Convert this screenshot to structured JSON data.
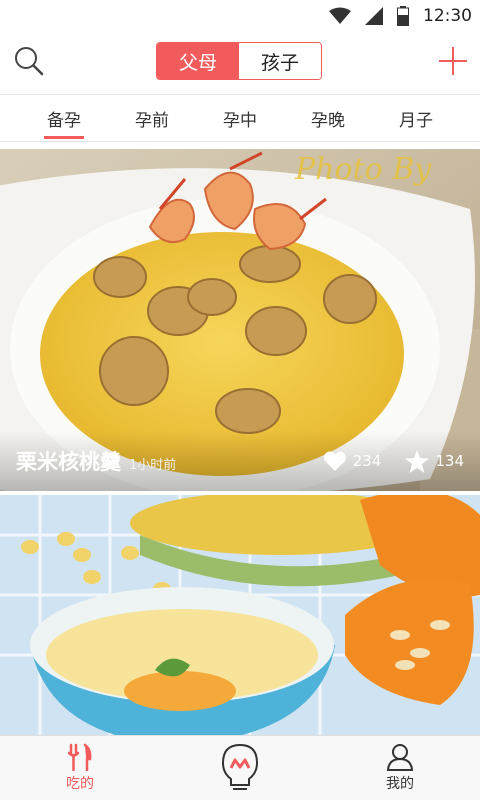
{
  "status_bar": {
    "time": "12:30"
  },
  "header": {
    "segments": [
      "父母",
      "孩子"
    ],
    "active_segment": 0
  },
  "stage_tabs": [
    "备孕",
    "孕前",
    "孕中",
    "孕晚",
    "月子"
  ],
  "selected_stage": 0,
  "feed": [
    {
      "title": "栗米核桃羹",
      "time": "1小时前",
      "likes": "234",
      "favorites": "134",
      "watermark": "Photo By"
    },
    {
      "title": "",
      "time": ""
    }
  ],
  "bottom_nav": {
    "eat_label": "吃的",
    "me_label": "我的"
  },
  "colors": {
    "accent": "#f15b5b"
  }
}
